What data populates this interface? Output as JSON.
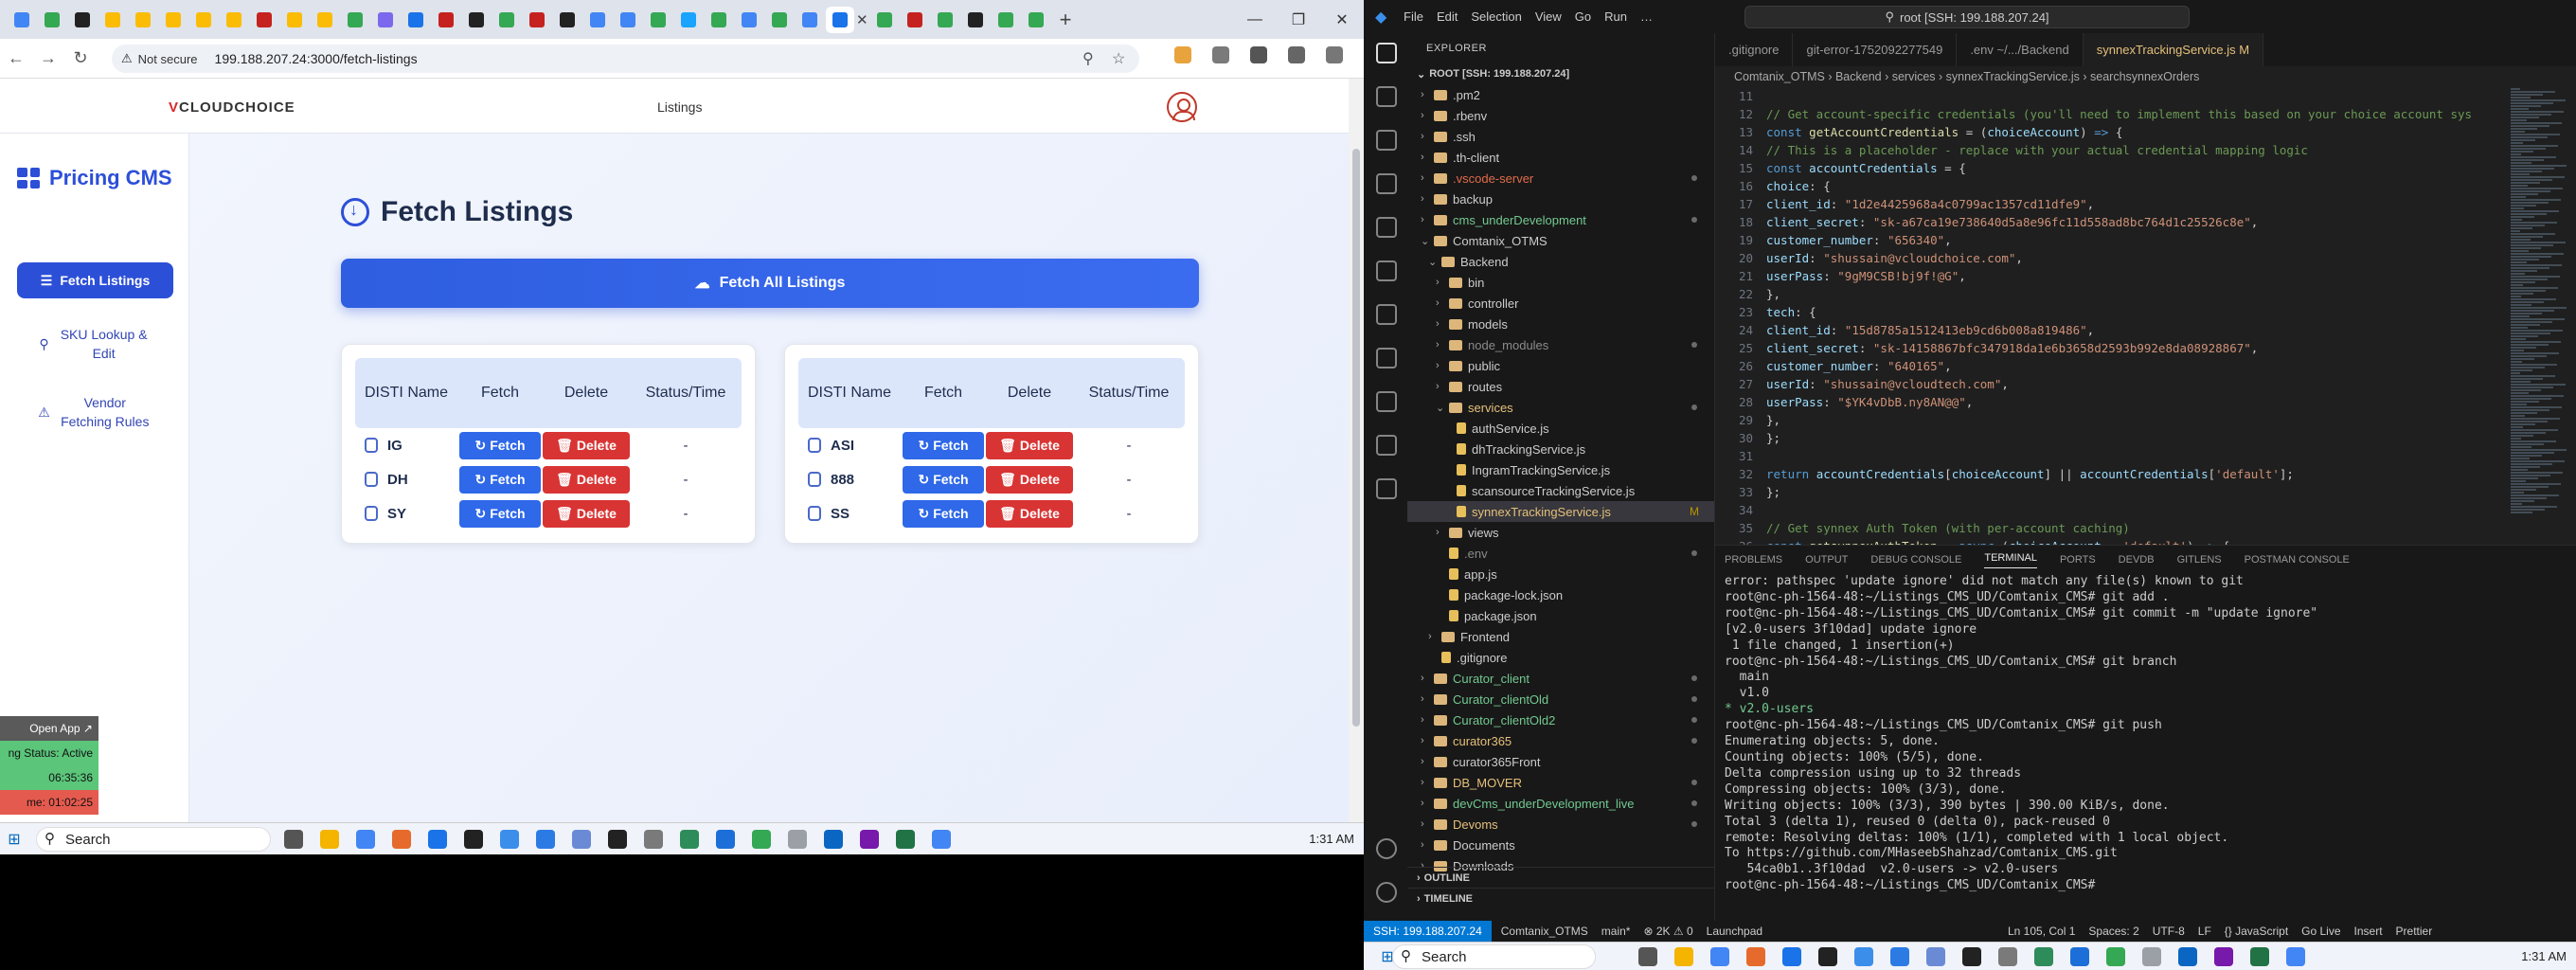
{
  "browser": {
    "url": "199.188.207.24:3000/fetch-listings",
    "security_label": "Not secure",
    "tab_colors": [
      "#4285f4",
      "#34a853",
      "#222222",
      "#fbbc05",
      "#fbbc05",
      "#fbbc05",
      "#fbbc05",
      "#fbbc05",
      "#c5221f",
      "#fbbc05",
      "#fbbc05",
      "#34a853",
      "#7b68ee",
      "#1a73e8",
      "#c5221f",
      "#222222",
      "#34a853",
      "#c5221f",
      "#222222",
      "#4285f4",
      "#4285f4",
      "#34a853",
      "#1aa3ff",
      "#34a853",
      "#4285f4",
      "#34a853",
      "#4285f4",
      "#1a73e8",
      "#34a853",
      "#c5221f",
      "#34a853",
      "#222222",
      "#34a853",
      "#34a853"
    ]
  },
  "app": {
    "logo_prefix": "V",
    "logo_text": "CLOUDCHOICE",
    "header_nav": "Listings",
    "brand": "Pricing CMS",
    "sidebar": [
      {
        "label": "Fetch Listings"
      },
      {
        "label": "SKU Lookup & Edit"
      },
      {
        "label": "Vendor Fetching Rules"
      }
    ],
    "page_title": "Fetch Listings",
    "fetch_all_label": "Fetch All Listings",
    "table_headers": {
      "disti": "DISTI Name",
      "fetch": "Fetch",
      "delete": "Delete",
      "status": "Status/Time"
    },
    "fetch_label": "Fetch",
    "delete_label": "Delete",
    "left_rows": [
      {
        "name": "IG",
        "status": "-"
      },
      {
        "name": "DH",
        "status": "-"
      },
      {
        "name": "SY",
        "status": "-"
      }
    ],
    "right_rows": [
      {
        "name": "ASI",
        "status": "-"
      },
      {
        "name": "888",
        "status": "-"
      },
      {
        "name": "SS",
        "status": "-"
      }
    ]
  },
  "floating": {
    "open_app": "Open App ↗",
    "status": "ng Status: Active",
    "time1": "06:35:36",
    "time2": "me: 01:02:25"
  },
  "taskbar": {
    "search": "Search",
    "clock": "1:31 AM"
  },
  "vscode": {
    "menu": [
      "File",
      "Edit",
      "Selection",
      "View",
      "Go",
      "Run",
      "…"
    ],
    "command_center": "root [SSH: 199.188.207.24]",
    "explorer_title": "EXPLORER",
    "root": "ROOT [SSH: 199.188.207.24]",
    "tree": [
      {
        "label": ".pm2",
        "depth": 1,
        "type": "folder"
      },
      {
        "label": ".rbenv",
        "depth": 1,
        "type": "folder"
      },
      {
        "label": ".ssh",
        "depth": 1,
        "type": "folder"
      },
      {
        "label": ".th-client",
        "depth": 1,
        "type": "folder"
      },
      {
        "label": ".vscode-server",
        "depth": 1,
        "type": "folder",
        "color": "#e06c4a"
      },
      {
        "label": "backup",
        "depth": 1,
        "type": "folder"
      },
      {
        "label": "cms_underDevelopment",
        "depth": 1,
        "type": "folder",
        "color": "#73c991"
      },
      {
        "label": "Comtanix_OTMS",
        "depth": 1,
        "type": "folder-open"
      },
      {
        "label": "Backend",
        "depth": 2,
        "type": "folder-open"
      },
      {
        "label": "bin",
        "depth": 3,
        "type": "folder"
      },
      {
        "label": "controller",
        "depth": 3,
        "type": "folder"
      },
      {
        "label": "models",
        "depth": 3,
        "type": "folder"
      },
      {
        "label": "node_modules",
        "depth": 3,
        "type": "folder",
        "color": "#8b8b8b"
      },
      {
        "label": "public",
        "depth": 3,
        "type": "folder"
      },
      {
        "label": "routes",
        "depth": 3,
        "type": "folder"
      },
      {
        "label": "services",
        "depth": 3,
        "type": "folder-open",
        "color": "#e5c07b"
      },
      {
        "label": "authService.js",
        "depth": 4,
        "type": "file"
      },
      {
        "label": "dhTrackingService.js",
        "depth": 4,
        "type": "file"
      },
      {
        "label": "IngramTrackingService.js",
        "depth": 4,
        "type": "file"
      },
      {
        "label": "scansourceTrackingService.js",
        "depth": 4,
        "type": "file"
      },
      {
        "label": "synnexTrackingService.js",
        "depth": 4,
        "type": "file",
        "sel": true,
        "color": "#e5c07b"
      },
      {
        "label": "views",
        "depth": 3,
        "type": "folder"
      },
      {
        "label": ".env",
        "depth": 3,
        "type": "file",
        "color": "#8b8b8b"
      },
      {
        "label": "app.js",
        "depth": 3,
        "type": "file"
      },
      {
        "label": "package-lock.json",
        "depth": 3,
        "type": "file"
      },
      {
        "label": "package.json",
        "depth": 3,
        "type": "file"
      },
      {
        "label": "Frontend",
        "depth": 2,
        "type": "folder"
      },
      {
        "label": ".gitignore",
        "depth": 2,
        "type": "file"
      },
      {
        "label": "Curator_client",
        "depth": 1,
        "type": "folder",
        "color": "#73c991"
      },
      {
        "label": "Curator_clientOld",
        "depth": 1,
        "type": "folder",
        "color": "#73c991"
      },
      {
        "label": "Curator_clientOld2",
        "depth": 1,
        "type": "folder",
        "color": "#73c991"
      },
      {
        "label": "curator365",
        "depth": 1,
        "type": "folder",
        "color": "#e5c07b"
      },
      {
        "label": "curator365Front",
        "depth": 1,
        "type": "folder"
      },
      {
        "label": "DB_MOVER",
        "depth": 1,
        "type": "folder",
        "color": "#e5c07b"
      },
      {
        "label": "devCms_underDevelopment_live",
        "depth": 1,
        "type": "folder",
        "color": "#73c991"
      },
      {
        "label": "Devoms",
        "depth": 1,
        "type": "folder",
        "color": "#e5c07b"
      },
      {
        "label": "Documents",
        "depth": 1,
        "type": "folder"
      },
      {
        "label": "Downloads",
        "depth": 1,
        "type": "folder"
      }
    ],
    "outline": "OUTLINE",
    "timeline": "TIMELINE",
    "tabs": [
      ".gitignore",
      "git-error-1752092277549",
      ".env  ~/.../Backend",
      "synnexTrackingService.js  M"
    ],
    "breadcrumb": "Comtanix_OTMS  ›  Backend  ›  services  ›  synnexTrackingService.js  ›  searchsynnexOrders",
    "panel_tabs": [
      "PROBLEMS",
      "OUTPUT",
      "DEBUG CONSOLE",
      "TERMINAL",
      "PORTS",
      "DEVDB",
      "GITLENS",
      "POSTMAN CONSOLE"
    ],
    "terminal": [
      "error: pathspec 'update ignore' did not match any file(s) known to git",
      "root@nc-ph-1564-48:~/Listings_CMS_UD/Comtanix_CMS# git add .",
      "root@nc-ph-1564-48:~/Listings_CMS_UD/Comtanix_CMS# git commit -m \"update ignore\"",
      "[v2.0-users 3f10dad] update ignore",
      " 1 file changed, 1 insertion(+)",
      "root@nc-ph-1564-48:~/Listings_CMS_UD/Comtanix_CMS# git branch",
      "  main",
      "  v1.0",
      "* v2.0-users",
      "root@nc-ph-1564-48:~/Listings_CMS_UD/Comtanix_CMS# git push",
      "Enumerating objects: 5, done.",
      "Counting objects: 100% (5/5), done.",
      "Delta compression using up to 32 threads",
      "Compressing objects: 100% (3/3), done.",
      "Writing objects: 100% (3/3), 390 bytes | 390.00 KiB/s, done.",
      "Total 3 (delta 1), reused 0 (delta 0), pack-reused 0",
      "remote: Resolving deltas: 100% (1/1), completed with 1 local object.",
      "To https://github.com/MHaseebShahzad/Comtanix_CMS.git",
      "   54ca0b1..3f10dad  v2.0-users -> v2.0-users",
      "root@nc-ph-1564-48:~/Listings_CMS_UD/Comtanix_CMS# "
    ],
    "status_remote": "SSH: 199.188.207.24",
    "status_items": [
      "Comtanix_OTMS",
      "main*",
      "⊗ 2K ⚠ 0",
      "Launchpad"
    ],
    "status_right": [
      "Ln 105, Col 1",
      "Spaces: 2",
      "UTF-8",
      "LF",
      "{} JavaScript",
      "Go Live",
      "Insert",
      "Prettier"
    ]
  }
}
